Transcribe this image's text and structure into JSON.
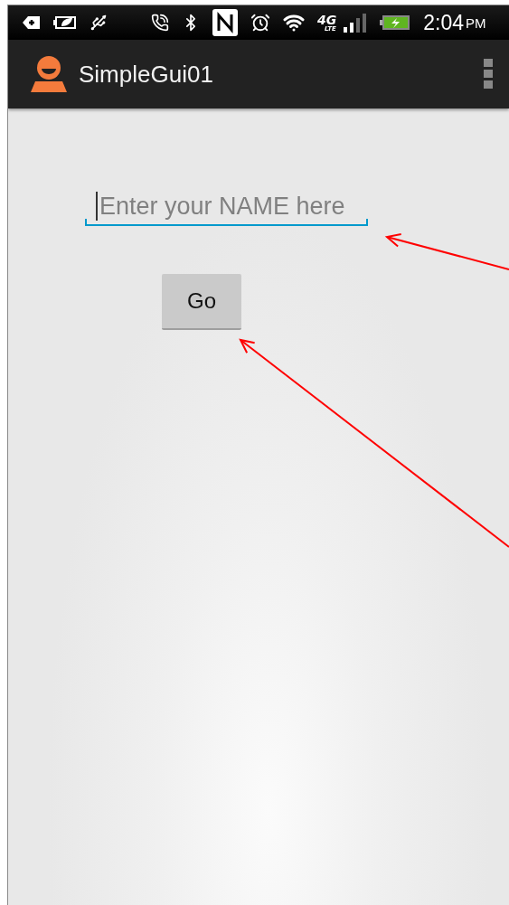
{
  "status_bar": {
    "network": "4G",
    "network_sub": "LTE",
    "time": "2:04",
    "period": "PM"
  },
  "app_bar": {
    "title": "SimpleGui01"
  },
  "name_field": {
    "placeholder": "Enter your NAME here",
    "focused": true
  },
  "go_button": {
    "label": "Go"
  }
}
